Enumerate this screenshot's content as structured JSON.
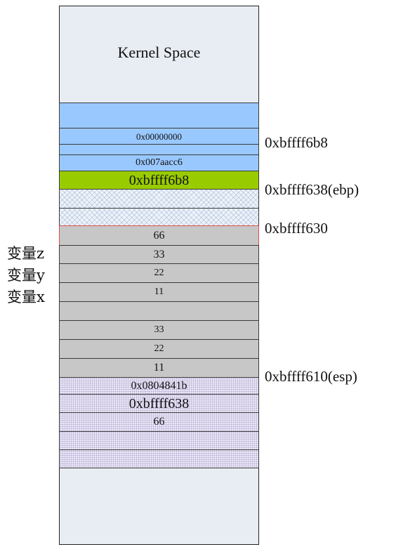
{
  "kernel_label": "Kernel Space",
  "cells": {
    "c1": "",
    "c2": "0x00000000",
    "c3": "",
    "c4": "0x007aacc6",
    "c5": "0xbffff6b8",
    "c6": "",
    "c7": "",
    "c8": "66",
    "c9": "33",
    "c10": "22",
    "c11": "11",
    "c12": "",
    "c13": "33",
    "c14": "22",
    "c15": "11",
    "c16": "0x0804841b",
    "c17": "0xbffff638",
    "c18": "66",
    "c19": "",
    "c20": ""
  },
  "addresses": {
    "a1": "0xbffff6b8",
    "a2": "0xbffff638(ebp)",
    "a3": "0xbffff630",
    "a4": "0xbffff610(esp)"
  },
  "variables": {
    "z": "变量z",
    "y": "变量y",
    "x": "变量x"
  },
  "colors": {
    "saved_frame": "#99c8ff",
    "saved_ebp": "#99cc00",
    "locals": "#c7c7c7",
    "highlight_border": "#e0504a"
  }
}
